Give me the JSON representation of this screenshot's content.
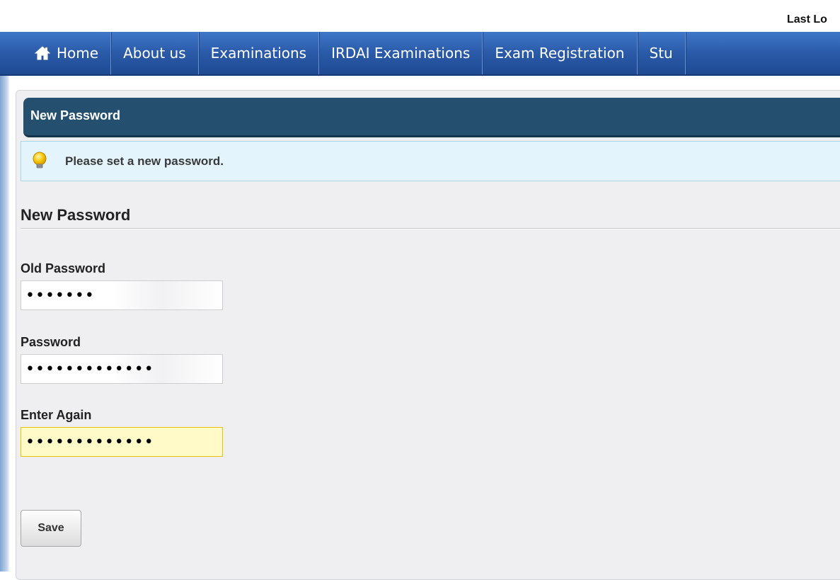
{
  "header": {
    "last_login_label": "Last Lo"
  },
  "nav": {
    "items": [
      {
        "label": "Home",
        "icon": "home-icon"
      },
      {
        "label": "About us"
      },
      {
        "label": "Examinations"
      },
      {
        "label": "IRDAI Examinations"
      },
      {
        "label": "Exam Registration"
      },
      {
        "label": "Stu"
      }
    ]
  },
  "panel": {
    "title": "New Password",
    "notice": {
      "icon": "lightbulb-icon",
      "text": "Please set a new password."
    },
    "section_title": "New Password"
  },
  "form": {
    "old_password": {
      "label": "Old Password",
      "value": "1234567"
    },
    "password": {
      "label": "Password",
      "value": "1234567890123"
    },
    "confirm_password": {
      "label": "Enter Again",
      "value": "1234567890123"
    },
    "save_label": "Save"
  },
  "colors": {
    "nav_blue": "#2a5aa8",
    "panel_header": "#244f6f",
    "notice_bg": "#e3f4fc",
    "focus_bg": "#fffac8"
  }
}
